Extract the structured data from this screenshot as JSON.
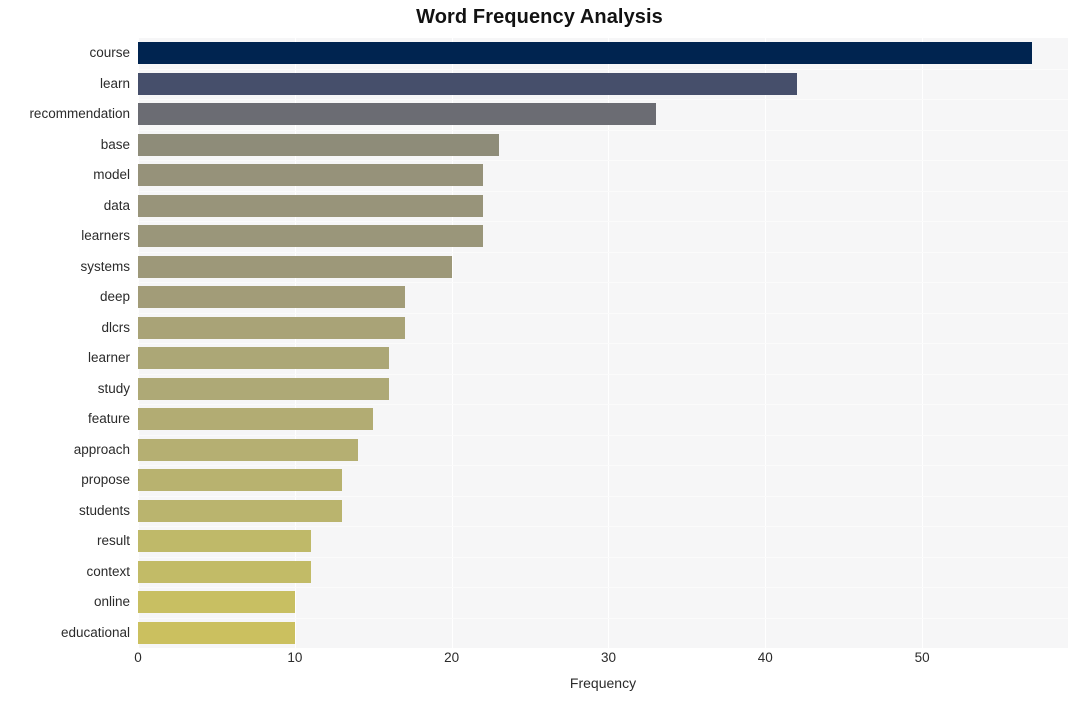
{
  "chart_data": {
    "type": "bar",
    "orientation": "horizontal",
    "title": "Word Frequency Analysis",
    "xlabel": "Frequency",
    "ylabel": "",
    "categories": [
      "course",
      "learn",
      "recommendation",
      "base",
      "model",
      "data",
      "learners",
      "systems",
      "deep",
      "dlcrs",
      "learner",
      "study",
      "feature",
      "approach",
      "propose",
      "students",
      "result",
      "context",
      "online",
      "educational"
    ],
    "values": [
      57,
      42,
      33,
      23,
      22,
      22,
      22,
      20,
      17,
      17,
      16,
      16,
      15,
      14,
      13,
      13,
      11,
      11,
      10,
      10
    ],
    "bar_colors": [
      "#002450",
      "#464f6b",
      "#6b6c73",
      "#8e8c79",
      "#96927a",
      "#98947a",
      "#9a967a",
      "#9d9879",
      "#a29c78",
      "#a9a377",
      "#aca776",
      "#aea976",
      "#b2ac73",
      "#b5af72",
      "#b8b26f",
      "#bab46e",
      "#bfb969",
      "#c2bb67",
      "#c8bf62",
      "#cbc05f"
    ],
    "xlim": [
      0,
      59.3
    ],
    "ylim_categories_count": 20,
    "xticks": [
      0,
      10,
      20,
      30,
      40,
      50
    ],
    "xtick_labels": [
      "0",
      "10",
      "20",
      "30",
      "40",
      "50"
    ],
    "grid": "vertical-white-gridlines",
    "legend": "none",
    "plot_background": "#f6f6f7",
    "figure_background": "#ffffff"
  }
}
